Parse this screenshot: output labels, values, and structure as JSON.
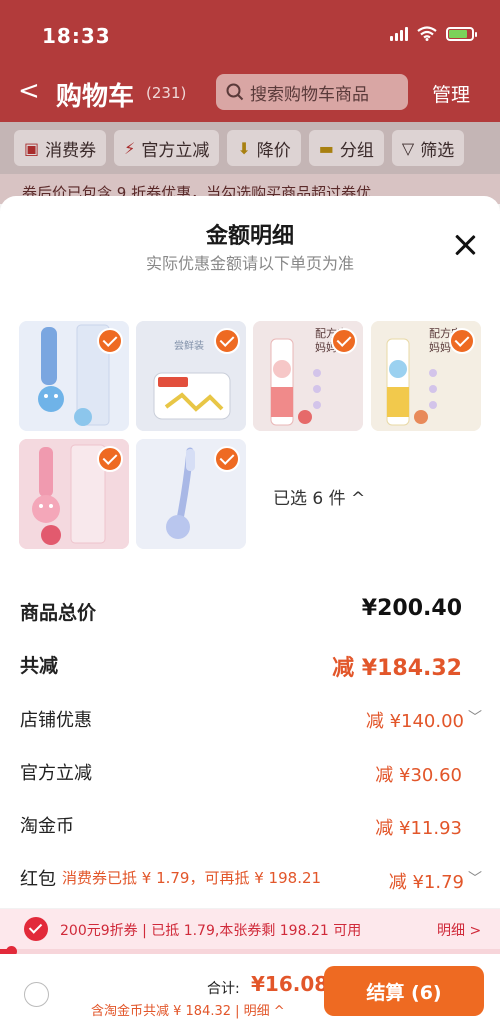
{
  "status_bar": {
    "time": "18:33"
  },
  "nav": {
    "back": "<",
    "title": "购物车",
    "count": "(231)",
    "search_placeholder": "搜索购物车商品",
    "manage": "管理"
  },
  "filters": [
    {
      "icon": "coupon-icon",
      "label": "消费券"
    },
    {
      "icon": "lightning-icon",
      "label": "官方立减"
    },
    {
      "icon": "arrow-down-icon",
      "label": "降价"
    },
    {
      "icon": "folder-icon",
      "label": "分组"
    },
    {
      "icon": "filter-icon",
      "label": "筛选"
    }
  ],
  "coupon_tip": "券后价已包含 9 折券优惠，当勾选购买商品超过券优",
  "sheet": {
    "title": "金额明细",
    "subtitle": "实际优惠金额请以下单页为准",
    "selected_count": "已选 6 件 ^",
    "rows": {
      "total_label": "商品总价",
      "total_value": "¥200.40",
      "reduce_label": "共减",
      "reduce_value": "减 ¥184.32",
      "store_label": "店铺优惠",
      "store_value": "减 ¥140.00",
      "official_label": "官方立减",
      "official_value": "减 ¥30.60",
      "coins_label": "淘金币",
      "coins_value": "减 ¥11.93",
      "redpack_label": "红包",
      "redpack_sub": "消费券已抵 ¥ 1.79，可再抵 ¥ 198.21",
      "redpack_value": "减 ¥1.79"
    }
  },
  "promo": {
    "text": "200元9折券 | 已抵 1.79,本张券剩 198.21 可用",
    "detail": "明细 >",
    "progress": 0.02
  },
  "bottom": {
    "sum_label": "合计:",
    "sum_value": "¥16.08",
    "sum_sub": "含淘金币共减 ¥ 184.32 | 明细 ^",
    "checkout": "结算 (6)"
  },
  "colors": {
    "accent": "#ee6a22",
    "red": "#e22a3a",
    "nav_bg": "#b23b3b"
  }
}
